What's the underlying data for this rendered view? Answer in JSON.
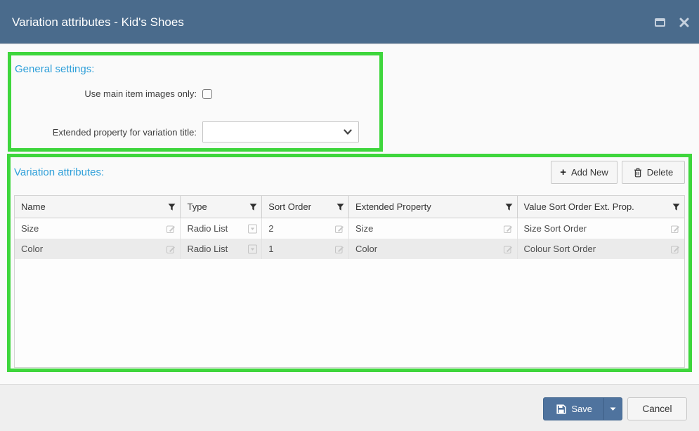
{
  "dialog": {
    "title": "Variation attributes - Kid's Shoes"
  },
  "general_settings": {
    "heading": "General settings:",
    "use_main_images_label": "Use main item images only:",
    "use_main_images_checked": false,
    "extended_property_label": "Extended property for variation title:",
    "extended_property_selected_value": ""
  },
  "variation_attributes": {
    "heading": "Variation attributes:",
    "add_new_label": "Add New",
    "delete_label": "Delete",
    "table": {
      "columns": [
        "Name",
        "Type",
        "Sort Order",
        "Extended Property",
        "Value Sort Order Ext. Prop."
      ],
      "rows": [
        {
          "name": "Size",
          "type": "Radio List",
          "sort_order": "2",
          "extended_property": "Size",
          "value_sort_order": "Size Sort Order"
        },
        {
          "name": "Color",
          "type": "Radio List",
          "sort_order": "1",
          "extended_property": "Color",
          "value_sort_order": "Colour Sort Order"
        }
      ]
    }
  },
  "footer": {
    "save_label": "Save",
    "cancel_label": "Cancel"
  },
  "colors": {
    "header_bg": "#4a6b8c",
    "section_heading_blue": "#2e9fd9",
    "highlight_green": "#3ed63c",
    "save_button_bg": "#4f739e",
    "footer_bg": "#efefef",
    "alt_row_bg": "#ebebeb"
  },
  "icons": {
    "header": [
      "maximize-icon",
      "close-icon"
    ],
    "table_header": "filter-funnel-icon",
    "text_cell": "edit-pencil-icon",
    "type_cell": "dropdown-box-icon",
    "add_new": "plus-icon",
    "delete": "trash-icon",
    "save": "floppy-disk-icon",
    "save_split": "caret-down-icon",
    "select": "chevron-down-icon"
  }
}
